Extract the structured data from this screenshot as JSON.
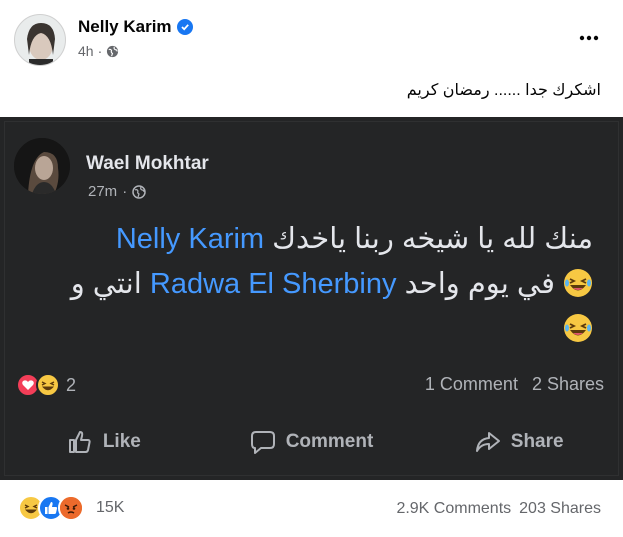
{
  "post": {
    "author": "Nelly Karim",
    "timestamp": "4h",
    "caption": "اشكرك جدا ...... رمضان كريم",
    "reactions_count": "15K",
    "comments": "2.9K Comments",
    "shares": "203 Shares"
  },
  "shared": {
    "author": "Wael Mokhtar",
    "timestamp": "27m",
    "text_part1": "منك لله يا شيخه ربنا ياخدك ",
    "mention1": "Nelly Karim",
    "text_part2": "انتي و ",
    "mention2": "Radwa El Sherbiny",
    "text_part3": " في يوم واحد ",
    "reactions_count": "2",
    "comments": "1 Comment",
    "shares": "2 Shares",
    "actions": {
      "like": "Like",
      "comment": "Comment",
      "share": "Share"
    }
  },
  "colors": {
    "mention": "#4599ff",
    "verified": "#1877f2",
    "dark_bg": "#242526"
  }
}
